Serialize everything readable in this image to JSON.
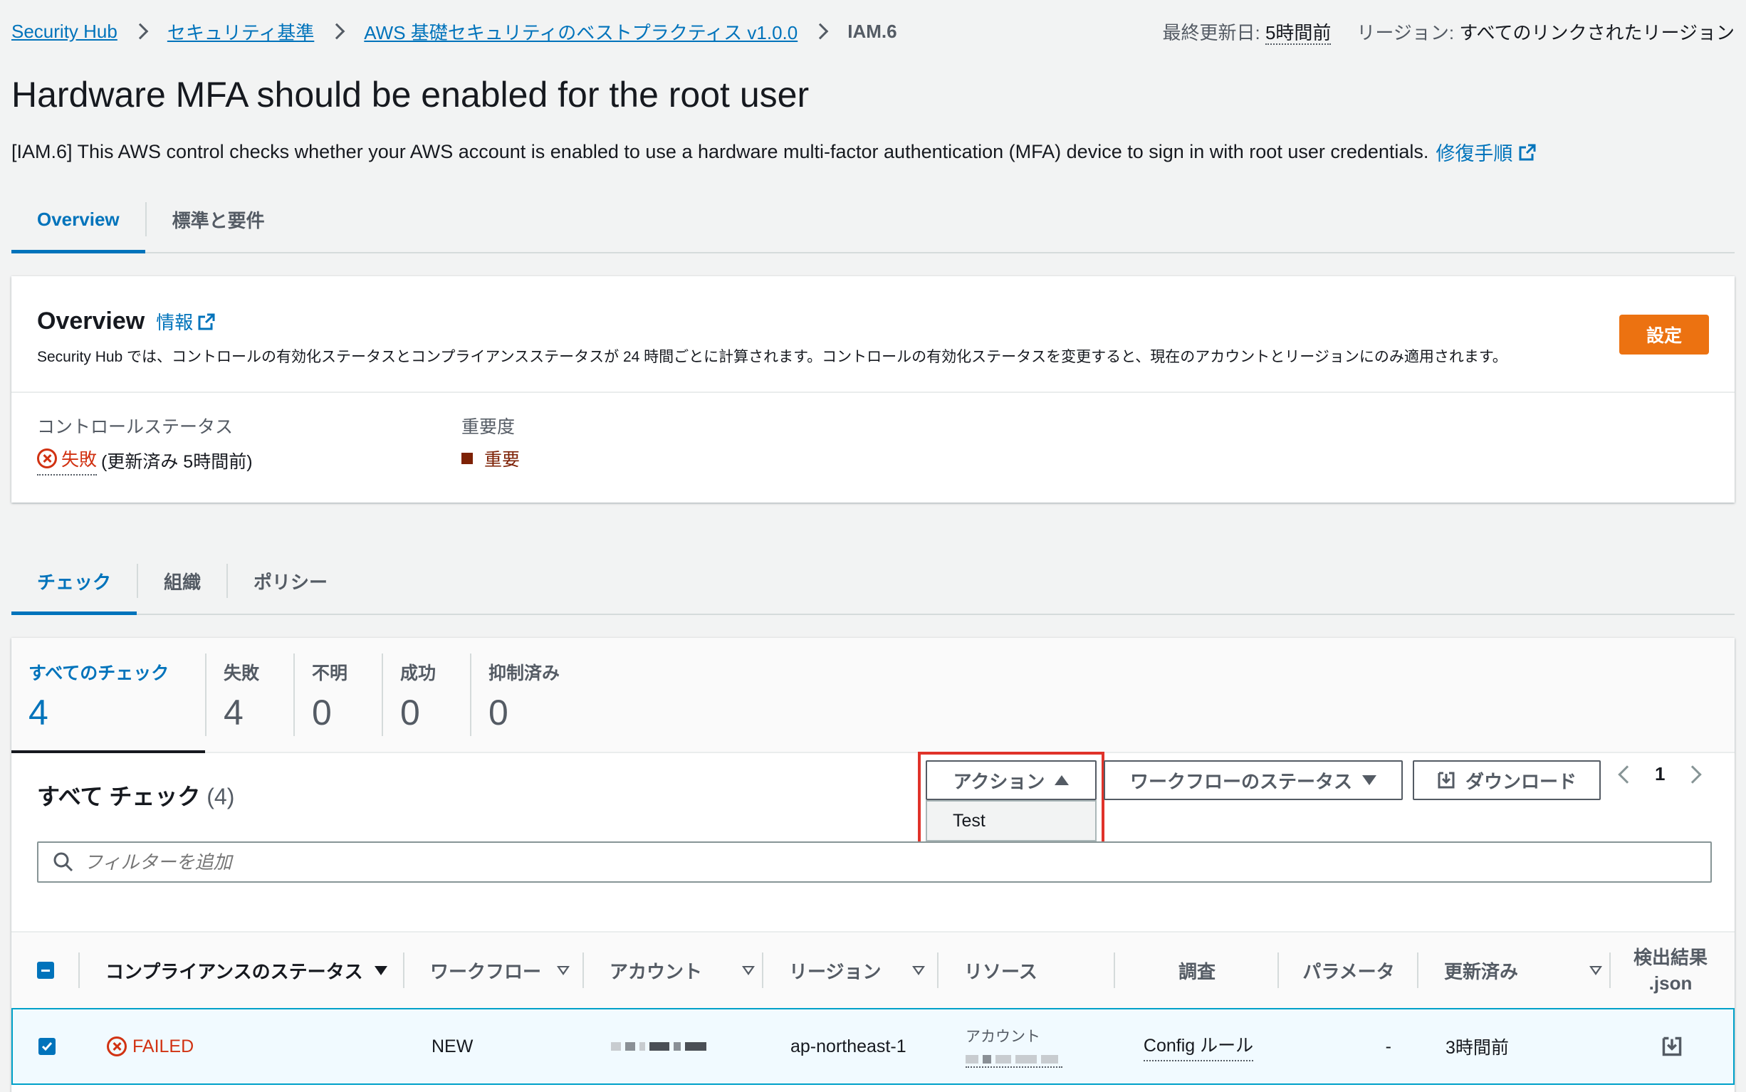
{
  "breadcrumb": {
    "items": [
      "Security Hub",
      "セキュリティ基準",
      "AWS 基礎セキュリティのベストプラクティス v1.0.0"
    ],
    "current": "IAM.6"
  },
  "meta": {
    "last_updated_label": "最終更新日:",
    "last_updated_value": "5時間前",
    "region_label": "リージョン:",
    "region_value": "すべてのリンクされたリージョン"
  },
  "page": {
    "title": "Hardware MFA should be enabled for the root user",
    "description": "[IAM.6] This AWS control checks whether your AWS account is enabled to use a hardware multi-factor authentication (MFA) device to sign in with root user credentials.",
    "remediation_link": "修復手順"
  },
  "top_tabs": [
    {
      "label": "Overview",
      "active": true
    },
    {
      "label": "標準と要件",
      "active": false
    }
  ],
  "overview": {
    "title": "Overview",
    "info_link": "情報",
    "subtitle": "Security Hub では、コントロールの有効化ステータスとコンプライアンスステータスが 24 時間ごとに計算されます。コントロールの有効化ステータスを変更すると、現在のアカウントとリージョンにのみ適用されます。",
    "settings_button": "設定",
    "control_status_label": "コントロールステータス",
    "control_status_value": "失敗",
    "control_status_detail": "(更新済み 5時間前)",
    "severity_label": "重要度",
    "severity_value": "重要"
  },
  "section_tabs": [
    {
      "label": "チェック",
      "active": true
    },
    {
      "label": "組織",
      "active": false
    },
    {
      "label": "ポリシー",
      "active": false
    }
  ],
  "counters": [
    {
      "label": "すべてのチェック",
      "value": "4",
      "active": true
    },
    {
      "label": "失敗",
      "value": "4",
      "active": false
    },
    {
      "label": "不明",
      "value": "0",
      "active": false
    },
    {
      "label": "成功",
      "value": "0",
      "active": false
    },
    {
      "label": "抑制済み",
      "value": "0",
      "active": false
    }
  ],
  "table": {
    "header_title": "すべて チェック",
    "header_count": "(4)",
    "actions_button": "アクション",
    "actions_menu": [
      "Test"
    ],
    "workflow_button": "ワークフローのステータス",
    "download_button": "ダウンロード",
    "page_number": "1",
    "filter_placeholder": "フィルターを追加",
    "columns": [
      "コンプライアンスのステータス",
      "ワークフロー",
      "アカウント",
      "リージョン",
      "リソース",
      "調査",
      "パラメータ",
      "更新済み",
      "検出結果 .json"
    ],
    "rows": [
      {
        "status": "FAILED",
        "workflow": "NEW",
        "region": "ap-northeast-1",
        "resource_label": "アカウント",
        "investigate": "Config ルール",
        "parameters": "-",
        "updated": "3時間前"
      }
    ]
  },
  "colors": {
    "primary_button": "#ec7211",
    "link": "#0073bb",
    "failed": "#d13212",
    "critical": "#7d2105",
    "highlight_border": "#e0332a"
  }
}
